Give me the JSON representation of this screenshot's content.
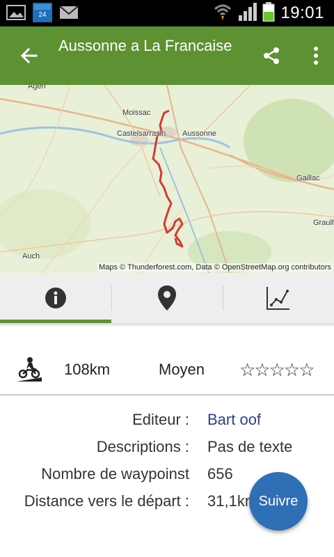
{
  "status_bar": {
    "time": "19:01",
    "left_icons": [
      "image-icon",
      "france24-app-icon",
      "mail-icon"
    ],
    "right_icons": [
      "wifi-icon",
      "signal-icon",
      "battery-icon"
    ],
    "battery_level": 0.55
  },
  "app_bar": {
    "title": "Aussonne a La Francaise",
    "back_icon": "arrow-left-icon",
    "share_icon": "share-icon",
    "more_icon": "more-vert-icon",
    "color": "#5e9132"
  },
  "map": {
    "places": [
      "Agen",
      "Moissac",
      "Castelsarrasin",
      "Aussonne",
      "Gaillac",
      "Graulh",
      "Auch"
    ],
    "attribution": "Maps © Thunderforest.com, Data © OpenStreetMap.org contributors",
    "route_color": "#d43a2f"
  },
  "tabs": [
    {
      "name": "info",
      "icon": "info-icon",
      "selected": true
    },
    {
      "name": "map",
      "icon": "location-pin-icon",
      "selected": false
    },
    {
      "name": "elevation",
      "icon": "line-chart-icon",
      "selected": false
    }
  ],
  "summary": {
    "activity_icon": "motorbike-icon",
    "distance": "108km",
    "difficulty": "Moyen",
    "stars_text": "☆☆☆☆☆",
    "rating": 0
  },
  "details": {
    "editor_label": "Editeur :",
    "editor_value": "Bart oof",
    "descriptions_label": "Descriptions :",
    "descriptions_value": "Pas de texte",
    "waypoints_label": "Nombre de waypoinst",
    "waypoints_value": "656",
    "distance_label": "Distance vers le départ :",
    "distance_value": "31,1km"
  },
  "fab": {
    "label": "Suivre",
    "color": "#2f6fb5"
  }
}
